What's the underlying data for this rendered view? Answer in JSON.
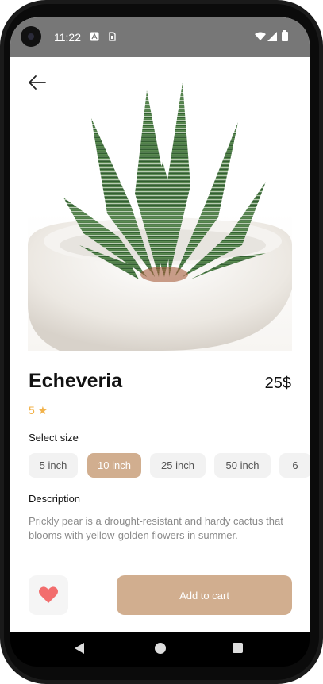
{
  "status_bar": {
    "time": "11:22"
  },
  "product": {
    "name": "Echeveria",
    "price": "25$",
    "rating": "5 ★"
  },
  "size_section": {
    "label": "Select size",
    "options": [
      "5 inch",
      "10 inch",
      "25 inch",
      "50 inch",
      "6"
    ],
    "selected": "10 inch"
  },
  "description": {
    "label": "Description",
    "text": "Prickly pear is a drought-resistant and hardy cactus that blooms with yellow-golden flowers in summer."
  },
  "actions": {
    "add_to_cart": "Add to cart"
  },
  "icons": {
    "back": "arrow-left-icon",
    "favorite": "heart-icon",
    "nav_back": "triangle-back-icon",
    "nav_home": "circle-home-icon",
    "nav_recent": "square-recent-icon"
  },
  "colors": {
    "accent": "#d1ae8f",
    "rating": "#f2b24a",
    "heart": "#f26d6d",
    "status_bar": "#777777"
  }
}
